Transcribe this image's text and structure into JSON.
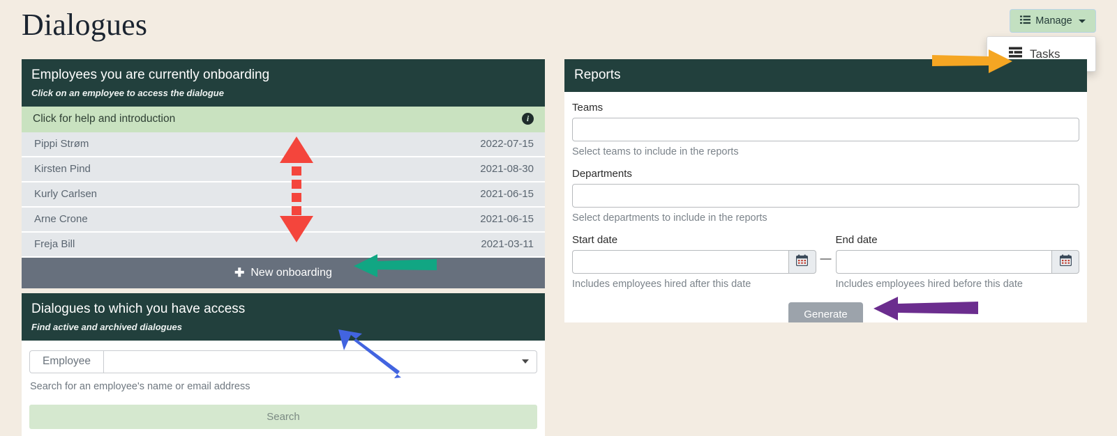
{
  "header": {
    "title": "Dialogues",
    "manage_button": {
      "label": "Manage",
      "icon": "list-icon"
    },
    "dropdown": {
      "items": [
        {
          "label": "Tasks",
          "icon": "tasks-icon"
        }
      ]
    }
  },
  "onboarding_card": {
    "title": "Employees you are currently onboarding",
    "subtitle": "Click on an employee to access the dialogue",
    "help_row": {
      "label": "Click for help and introduction",
      "icon": "info-icon"
    },
    "employees": [
      {
        "name": "Pippi Strøm",
        "date": "2022-07-15"
      },
      {
        "name": "Kirsten Pind",
        "date": "2021-08-30"
      },
      {
        "name": "Kurly Carlsen",
        "date": "2021-06-15"
      },
      {
        "name": "Arne Crone",
        "date": "2021-06-15"
      },
      {
        "name": "Freja Bill",
        "date": "2021-03-11"
      }
    ],
    "footer_button": {
      "label": "New onboarding",
      "icon": "plus-icon"
    }
  },
  "access_card": {
    "title": "Dialogues to which you have access",
    "subtitle": "Find active and archived dialogues",
    "employee_field": {
      "prefix_label": "Employee",
      "value": "",
      "placeholder": "",
      "icon": "chevron-down-icon"
    },
    "help_text": "Search for an employee's name or email address",
    "search_button": {
      "label": "Search"
    }
  },
  "reports_card": {
    "title": "Reports",
    "teams": {
      "label": "Teams",
      "value": "",
      "help": "Select teams to include in the reports"
    },
    "departments": {
      "label": "Departments",
      "value": "",
      "help": "Select departments to include in the reports"
    },
    "start_date": {
      "label": "Start date",
      "value": "",
      "help": "Includes employees hired after this date",
      "icon": "calendar-icon"
    },
    "end_date": {
      "label": "End date",
      "value": "",
      "help": "Includes employees hired before this date",
      "icon": "calendar-icon"
    },
    "separator": "—",
    "generate_button": {
      "label": "Generate"
    }
  },
  "colors": {
    "page_background": "#f3ece2",
    "header_dark": "#22403d",
    "help_green": "#c9e2c0",
    "row_gray": "#e4e7ea",
    "footer_slate": "#67707d",
    "manage_green": "#c3e0c1",
    "search_green": "#d5e8cf",
    "generate_gray": "#9ca3ab",
    "arrow_red": "#f4453c",
    "arrow_teal": "#11a683",
    "arrow_blue": "#4264e0",
    "arrow_purple": "#6b2d8e",
    "arrow_orange": "#f5a623"
  },
  "annotations": [
    {
      "name": "red-double-arrow",
      "color": "#f4453c",
      "direction": "vertical-dashed-double"
    },
    {
      "name": "teal-arrow",
      "color": "#11a683",
      "direction": "left"
    },
    {
      "name": "blue-arrow",
      "color": "#4264e0",
      "direction": "up-left"
    },
    {
      "name": "purple-arrow",
      "color": "#6b2d8e",
      "direction": "left"
    },
    {
      "name": "orange-arrow",
      "color": "#f5a623",
      "direction": "right"
    }
  ]
}
